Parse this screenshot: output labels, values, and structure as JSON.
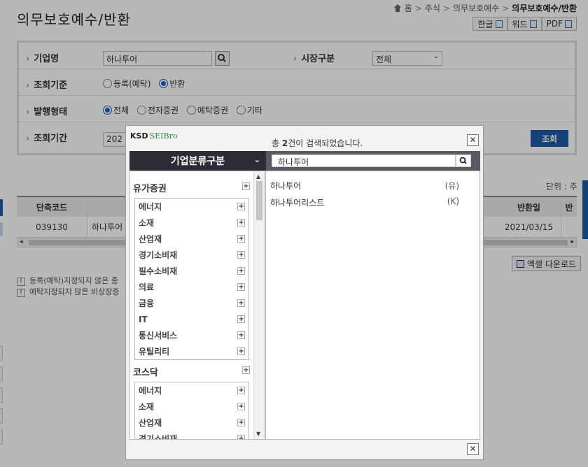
{
  "page": {
    "title": "의무보호예수/반환",
    "breadcrumb": [
      "홈",
      "주식",
      "의무보호예수",
      "의무보호예수/반환"
    ],
    "export_buttons": [
      "한글",
      "워드",
      "PDF"
    ]
  },
  "search": {
    "company_label": "기업명",
    "company_value": "하나투어",
    "market_label": "시장구분",
    "market_value": "전체",
    "basis_label": "조회기준",
    "basis_options": [
      "등록(예탁)",
      "반환"
    ],
    "basis_selected": "반환",
    "issue_label": "발행형태",
    "issue_options": [
      "전체",
      "전자증권",
      "예탁증권",
      "기타"
    ],
    "issue_selected": "전체",
    "period_label": "조회기간",
    "period_value": "202",
    "search_button": "조회"
  },
  "grid": {
    "unit": "단위 : 주",
    "headers": [
      "단축코드",
      "",
      "",
      "반환일",
      "반"
    ],
    "rows": [
      {
        "code": "039130",
        "name": "하나투어",
        "date": "2021/03/15"
      }
    ],
    "excel_button": "엑셀 다운로드"
  },
  "notes": [
    "등록(예탁)지정되지 않은 종",
    "예탁지정되지 않은 비상장증"
  ],
  "popup": {
    "logo": "KSD",
    "logo_sub": "SEIBro",
    "result_prefix": "총",
    "result_count": "2",
    "result_suffix": "건이 검색되었습니다.",
    "category_header": "기업분류구분",
    "search_value": "하나투어",
    "groups": [
      {
        "name": "유가증권",
        "items": [
          "에너지",
          "소재",
          "산업재",
          "경기소비재",
          "필수소비재",
          "의료",
          "금융",
          "IT",
          "통신서비스",
          "유틸리티"
        ]
      },
      {
        "name": "코스닥",
        "items": [
          "에너지",
          "소재",
          "산업재",
          "경기소비재"
        ]
      }
    ],
    "results": [
      {
        "name": "하나투어",
        "type": "(유)"
      },
      {
        "name": "하나투어리스트",
        "type": "(K)"
      }
    ]
  },
  "colors": {
    "accent": "#1d5aa7",
    "header_dark": "#2d2d35",
    "overlay": "rgba(0,0,0,0.28)"
  }
}
